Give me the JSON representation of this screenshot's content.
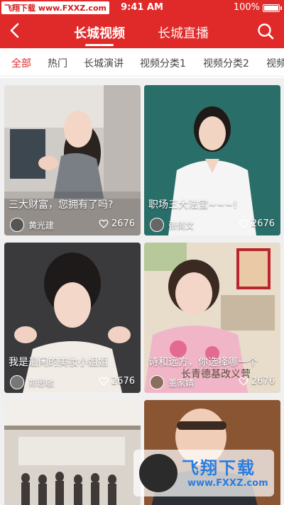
{
  "status": {
    "watermark": "飞翔下载 www.FXXZ.com",
    "time": "9:41 AM",
    "battery": "100%"
  },
  "nav": {
    "tabs": [
      {
        "label": "长城视频",
        "active": true
      },
      {
        "label": "长城直播",
        "active": false
      }
    ]
  },
  "categories": [
    {
      "label": "全部",
      "active": true
    },
    {
      "label": "热门",
      "active": false
    },
    {
      "label": "长城演讲",
      "active": false
    },
    {
      "label": "视频分类1",
      "active": false
    },
    {
      "label": "视频分类2",
      "active": false
    },
    {
      "label": "视频",
      "active": false
    }
  ],
  "cards": [
    {
      "title": "三大财富，您拥有了吗?",
      "author": "黄光建",
      "likes": "2676"
    },
    {
      "title": "职场三大法宝~~~!",
      "author": "张倩文",
      "likes": "2676"
    },
    {
      "title": "我是最闲的美妆小姐姐",
      "author": "郑思敏",
      "likes": "2676"
    },
    {
      "title": "诗和远方，你选择哪一个",
      "author": "董家婧",
      "likes": "2676"
    },
    {
      "title": "",
      "author": "",
      "likes": ""
    },
    {
      "title": "",
      "author": "",
      "likes": ""
    }
  ],
  "overlay": {
    "card4_text": "长青德基改义营",
    "logo_big": "飞翔下载",
    "logo_url": "www.FXXZ.com"
  },
  "colors": {
    "brand": "#e02a2a"
  }
}
